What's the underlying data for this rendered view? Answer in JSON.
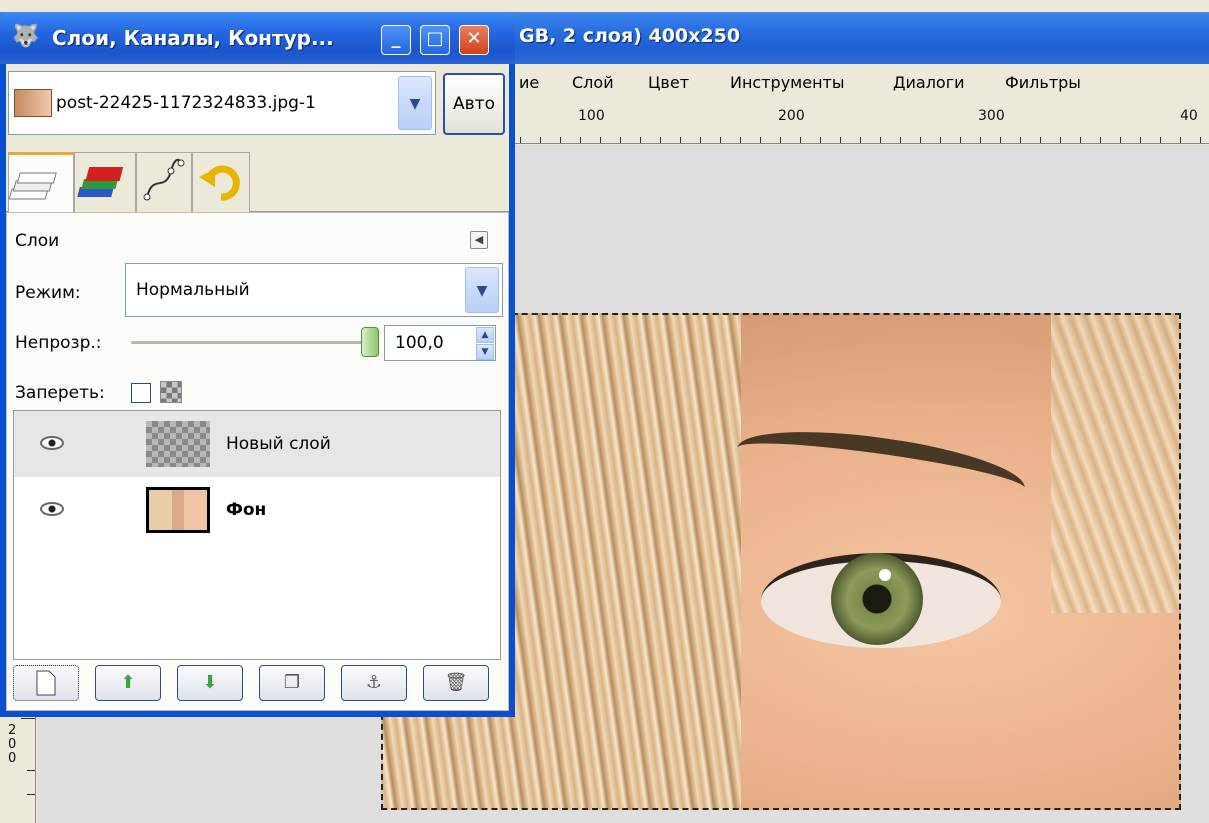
{
  "image_window": {
    "title_visible": "GB, 2 слоя) 400x250",
    "menu": [
      "ие",
      "Слой",
      "Цвет",
      "Инструменты",
      "Диалоги",
      "Фильтры"
    ],
    "hruler_labels": [
      "100",
      "200",
      "300",
      "40"
    ],
    "vruler_label_chars": [
      "2",
      "0",
      "0"
    ]
  },
  "dialog": {
    "title": "Слои, Каналы, Контур...",
    "controls": {
      "minimize": "_",
      "maximize": "□",
      "close": "✕"
    },
    "image_combo_value": "post-22425-1172324833.jpg-1",
    "auto_label": "Авто",
    "tabs": [
      "layers-tab-icon",
      "channels-tab-icon",
      "paths-tab-icon",
      "undo-tab-icon"
    ],
    "panel_title": "Слои",
    "mode_label": "Режим:",
    "mode_value": "Нормальный",
    "opacity_label": "Непрозр.:",
    "opacity_value": "100,0",
    "lock_label": "Запереть:",
    "layers": [
      {
        "name": "Новый слой",
        "visible": true,
        "selected": true
      },
      {
        "name": "Фон",
        "visible": true,
        "selected": false
      }
    ],
    "buttons": [
      "new-layer-icon",
      "raise-layer-icon",
      "lower-layer-icon",
      "duplicate-layer-icon",
      "anchor-layer-icon",
      "delete-layer-icon"
    ]
  },
  "colors": {
    "titlebar": "#2566e0",
    "window_bg": "#ece9d8",
    "close_button": "#d0421c"
  }
}
